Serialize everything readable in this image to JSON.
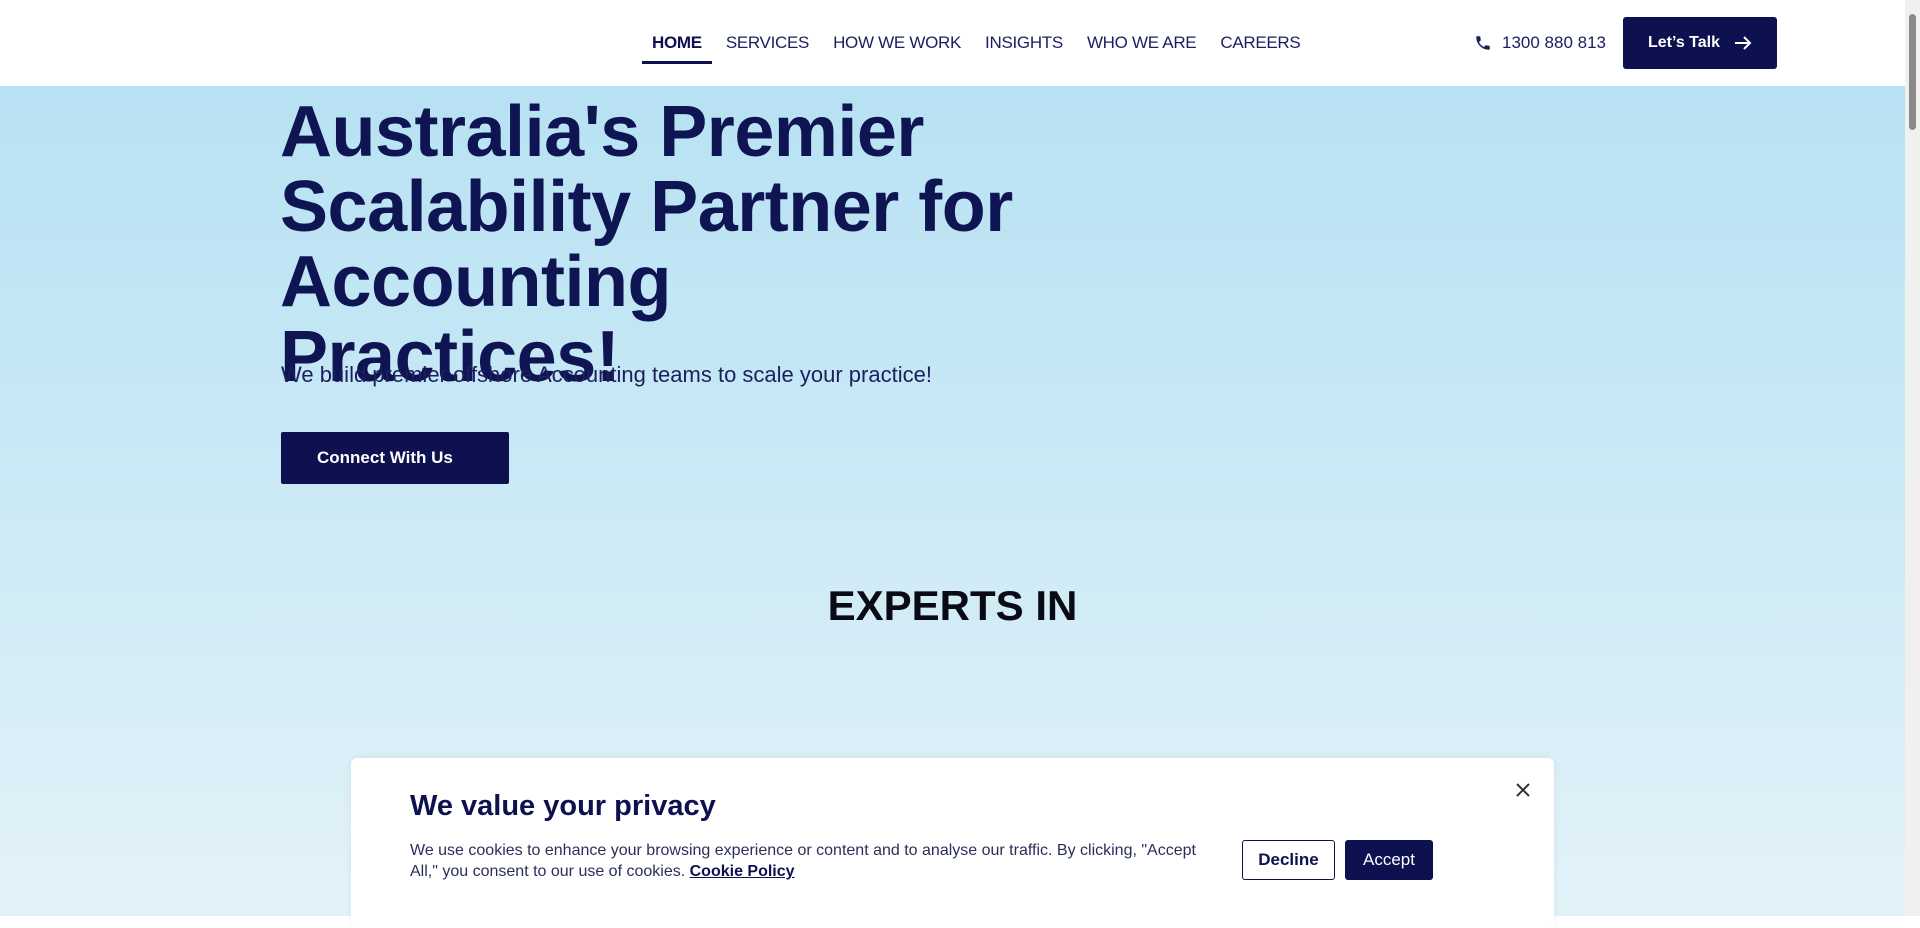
{
  "header": {
    "nav": [
      {
        "label": "HOME",
        "active": true
      },
      {
        "label": "SERVICES"
      },
      {
        "label": "HOW WE WORK"
      },
      {
        "label": "INSIGHTS"
      },
      {
        "label": "WHO WE ARE"
      },
      {
        "label": "CAREERS"
      }
    ],
    "phone": "1300 880 813",
    "cta_label": "Let’s Talk"
  },
  "hero": {
    "title_lines": [
      "Australia's Premier",
      "Scalability Partner for",
      "Accounting Practices!"
    ],
    "subtitle": "We build premier offshore Accounting teams to scale your practice!",
    "button_label": "Connect With Us"
  },
  "experts": {
    "heading": "EXPERTS IN"
  },
  "cookie_banner": {
    "title": "We value your privacy",
    "text": "We use cookies to enhance your browsing experience or content and to analyse our traffic. By clicking, \"Accept All,\" you consent to our use of cookies.",
    "link_label": "Cookie Policy",
    "decline_label": "Decline",
    "accept_label": "Accept"
  },
  "colors": {
    "brand_navy": "#0d1150",
    "hero_gradient_top": "#b3e0f2",
    "hero_gradient_bottom": "#e3f2f9"
  },
  "icons": {
    "phone": "phone-icon",
    "arrow": "arrow-right-icon",
    "close": "close-icon"
  }
}
